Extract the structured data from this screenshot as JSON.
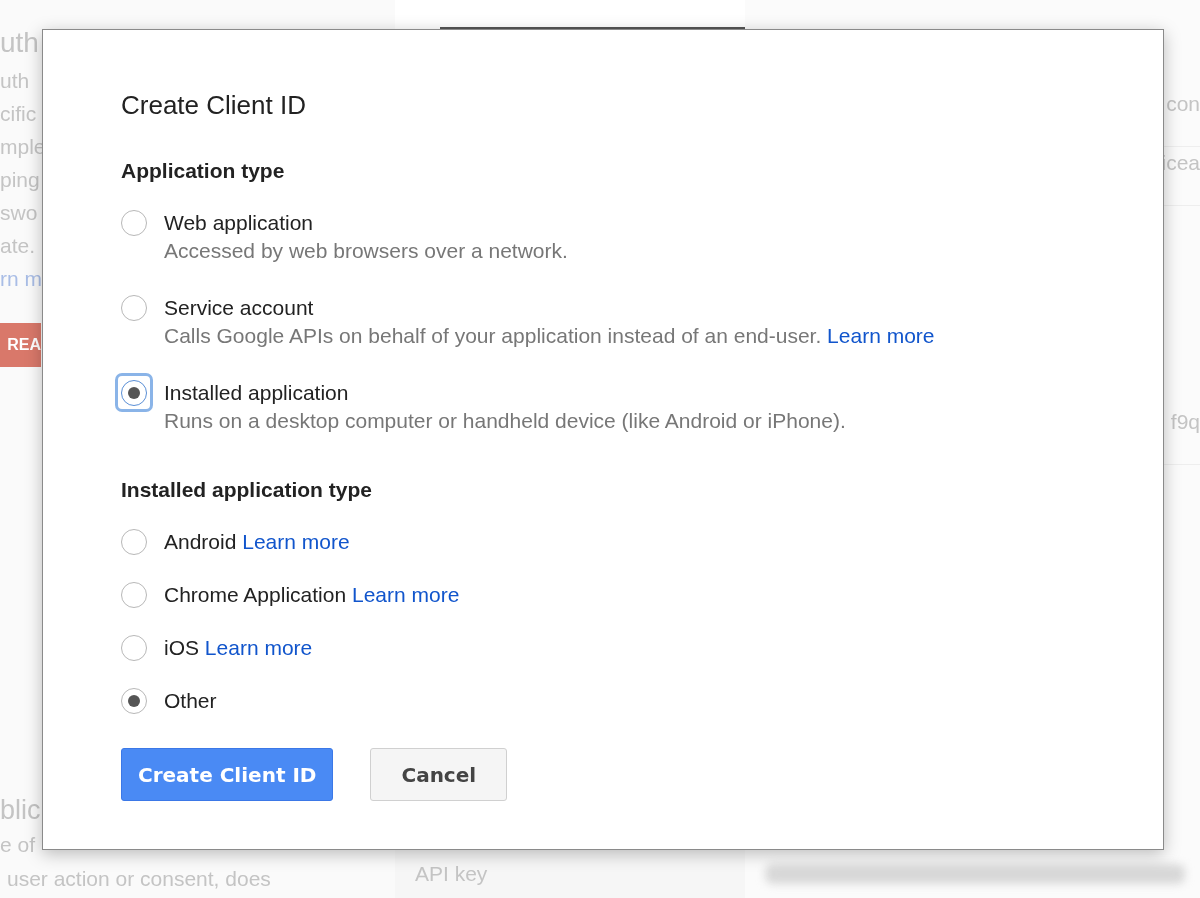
{
  "background": {
    "left_lines": [
      {
        "text": "uth",
        "kind": "heading"
      },
      {
        "text": "uth",
        "kind": "text"
      },
      {
        "text": "cific",
        "kind": "text"
      },
      {
        "text": "mple",
        "kind": "text"
      },
      {
        "text": "ping",
        "kind": "text"
      },
      {
        "text": "swo",
        "kind": "text"
      },
      {
        "text": "ate.",
        "kind": "text"
      },
      {
        "text": "rn m",
        "kind": "link"
      }
    ],
    "left_button": "REA",
    "bottom_heading": "blic",
    "bottom_lines": [
      "e of",
      "user action or consent, does"
    ],
    "api_key_label": "API key",
    "right_cells": [
      "con",
      "icea",
      "f9q"
    ]
  },
  "dialog": {
    "title": "Create Client ID",
    "sections": [
      {
        "heading": "Application type",
        "options": [
          {
            "label": "Web application",
            "description": "Accessed by web browsers over a network.",
            "selected": false,
            "focused": false
          },
          {
            "label": "Service account",
            "description": "Calls Google APIs on behalf of your application instead of an end-user.",
            "link": "Learn more",
            "selected": false,
            "focused": false
          },
          {
            "label": "Installed application",
            "description": "Runs on a desktop computer or handheld device (like Android or iPhone).",
            "selected": true,
            "focused": true
          }
        ]
      },
      {
        "heading": "Installed application type",
        "options": [
          {
            "label": "Android",
            "link": "Learn more",
            "selected": false,
            "focused": false
          },
          {
            "label": "Chrome Application",
            "link": "Learn more",
            "selected": false,
            "focused": false
          },
          {
            "label": "iOS",
            "link": "Learn more",
            "selected": false,
            "focused": false
          },
          {
            "label": "Other",
            "selected": true,
            "focused": false
          }
        ]
      }
    ],
    "buttons": [
      {
        "label": "Create Client ID",
        "kind": "primary"
      },
      {
        "label": "Cancel",
        "kind": "secondary"
      }
    ]
  }
}
